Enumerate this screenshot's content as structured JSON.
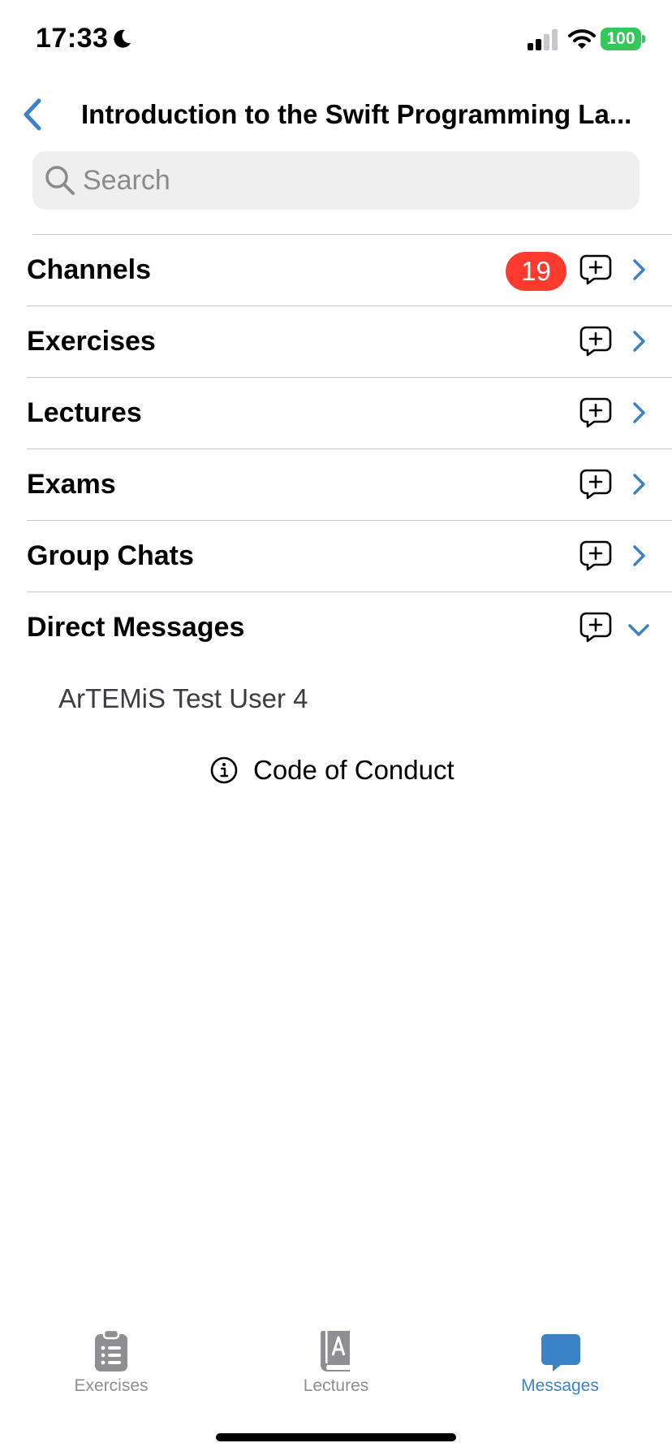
{
  "status_bar": {
    "time": "17:33",
    "battery": "100"
  },
  "nav": {
    "title": "Introduction to the Swift Programming La..."
  },
  "search": {
    "placeholder": "Search"
  },
  "sections": [
    {
      "label": "Channels",
      "badge": "19",
      "expanded": false
    },
    {
      "label": "Exercises",
      "expanded": false
    },
    {
      "label": "Lectures",
      "expanded": false
    },
    {
      "label": "Exams",
      "expanded": false
    },
    {
      "label": "Group Chats",
      "expanded": false
    },
    {
      "label": "Direct Messages",
      "expanded": true
    }
  ],
  "direct_messages": [
    {
      "name": "ArTEMiS Test User 4"
    }
  ],
  "code_of_conduct": {
    "label": "Code of Conduct"
  },
  "tab_bar": {
    "tabs": [
      {
        "label": "Exercises",
        "icon": "clipboard-list-icon",
        "active": false
      },
      {
        "label": "Lectures",
        "icon": "book-icon",
        "active": false
      },
      {
        "label": "Messages",
        "icon": "chat-bubble-icon",
        "active": true
      }
    ]
  },
  "colors": {
    "accent": "#3b83c9",
    "badge": "#ff3b30",
    "battery": "#34c759",
    "inactive": "#8e8e93"
  }
}
